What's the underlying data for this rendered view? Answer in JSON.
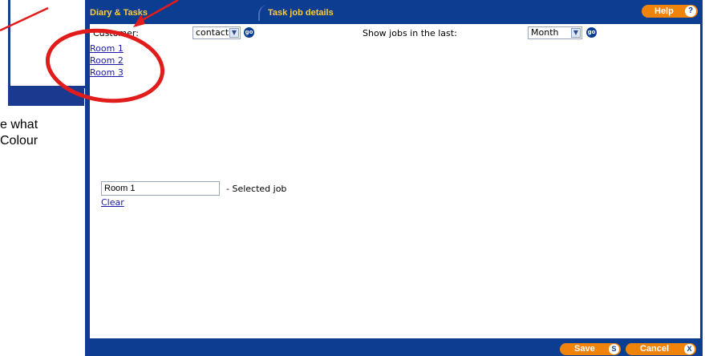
{
  "background_doc": {
    "text_line1": "e what",
    "text_line2": "Colour"
  },
  "tabs": [
    {
      "label": "Diary & Tasks"
    },
    {
      "label": "Task job details"
    }
  ],
  "help": {
    "label": "Help",
    "key": "?"
  },
  "filters": {
    "customer_label": "Customer:",
    "customer_value": "contact",
    "jobs_label": "Show jobs in the last:",
    "jobs_value": "Month",
    "go": "go"
  },
  "rooms": [
    "Room 1",
    "Room 2",
    "Room 3"
  ],
  "selection": {
    "value": "Room 1",
    "suffix": "- Selected job",
    "clear": "Clear"
  },
  "footer": {
    "save": "Save",
    "save_key": "S",
    "cancel": "Cancel",
    "cancel_key": "X"
  },
  "colors": {
    "chrome": "#0b3d91",
    "tab_text": "#ffcc33",
    "button": "#f0830a",
    "annotation": "#e21b1b"
  }
}
